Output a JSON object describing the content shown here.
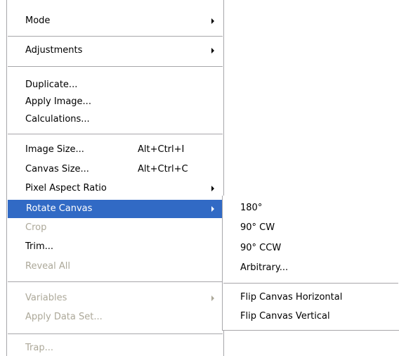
{
  "main_menu": {
    "items": [
      {
        "label": "Mode",
        "has_submenu": true,
        "enabled": true
      },
      {
        "label": "Adjustments",
        "has_submenu": true,
        "enabled": true
      },
      {
        "label": "Duplicate...",
        "enabled": true
      },
      {
        "label": "Apply Image...",
        "enabled": true
      },
      {
        "label": "Calculations...",
        "enabled": true
      },
      {
        "label": "Image Size...",
        "shortcut": "Alt+Ctrl+I",
        "enabled": true
      },
      {
        "label": "Canvas Size...",
        "shortcut": "Alt+Ctrl+C",
        "enabled": true
      },
      {
        "label": "Pixel Aspect Ratio",
        "has_submenu": true,
        "enabled": true
      },
      {
        "label": "Rotate Canvas",
        "has_submenu": true,
        "enabled": true,
        "highlighted": true
      },
      {
        "label": "Crop",
        "enabled": false
      },
      {
        "label": "Trim...",
        "enabled": true
      },
      {
        "label": "Reveal All",
        "enabled": false
      },
      {
        "label": "Variables",
        "has_submenu": true,
        "enabled": false
      },
      {
        "label": "Apply Data Set...",
        "enabled": false
      },
      {
        "label": "Trap...",
        "enabled": false
      }
    ]
  },
  "rotate_canvas_submenu": {
    "items": [
      {
        "label": "180°"
      },
      {
        "label": "90° CW"
      },
      {
        "label": "90° CCW"
      },
      {
        "label": "Arbitrary..."
      },
      {
        "label": "Flip Canvas Horizontal"
      },
      {
        "label": "Flip Canvas Vertical"
      }
    ]
  },
  "colors": {
    "highlight": "#316ac5",
    "disabled_text": "#aca899",
    "border": "#a7a6aa"
  }
}
